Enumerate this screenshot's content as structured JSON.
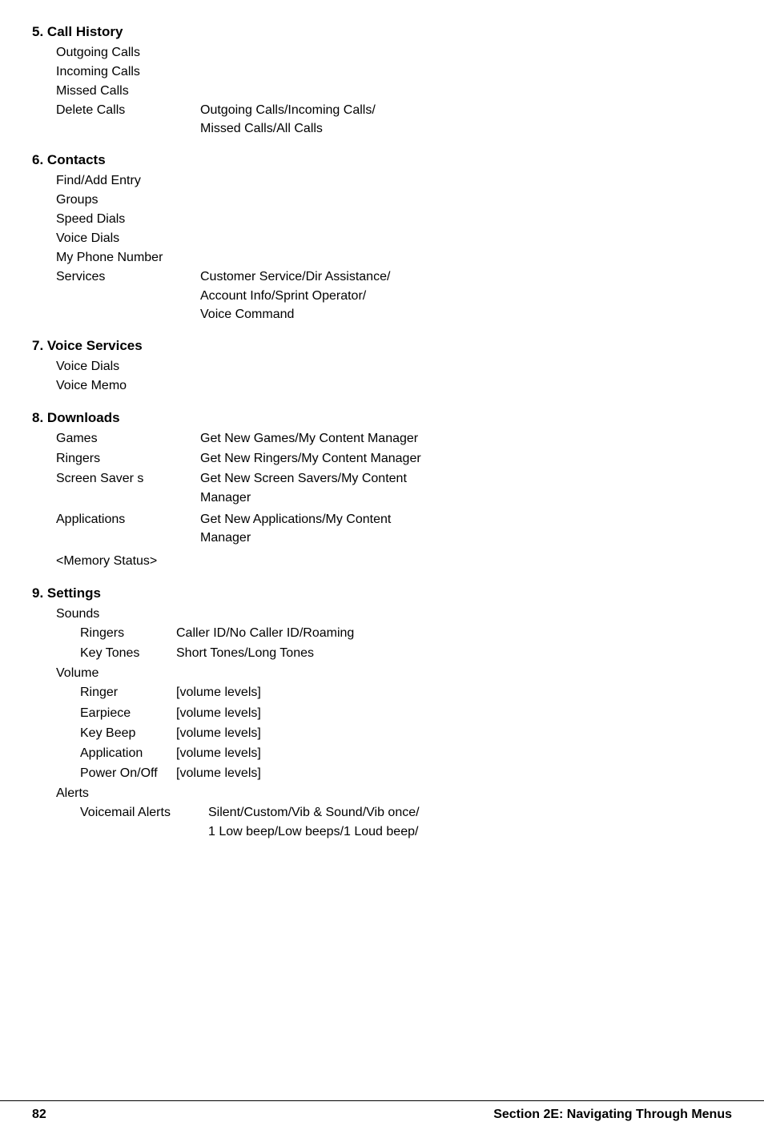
{
  "sections": [
    {
      "id": "s5",
      "number": "5.",
      "title": "Call History",
      "items": [
        {
          "label": "Outgoing Calls",
          "value": ""
        },
        {
          "label": "Incoming Calls",
          "value": ""
        },
        {
          "label": "Missed Calls",
          "value": ""
        },
        {
          "label": "Delete Calls",
          "value": "Outgoing Calls/Incoming Calls/\nMissed Calls/All Calls"
        }
      ]
    },
    {
      "id": "s6",
      "number": "6.",
      "title": "Contacts",
      "items": [
        {
          "label": "Find/Add Entry",
          "value": ""
        },
        {
          "label": "Groups",
          "value": ""
        },
        {
          "label": "Speed Dials",
          "value": ""
        },
        {
          "label": "Voice Dials",
          "value": ""
        },
        {
          "label": "My Phone Number",
          "value": ""
        },
        {
          "label": "Services",
          "value": "Customer Service/Dir Assistance/\nAccount Info/Sprint Operator/\nVoice Command"
        }
      ]
    },
    {
      "id": "s7",
      "number": "7.",
      "title": "Voice Services",
      "items": [
        {
          "label": "Voice Dials",
          "value": ""
        },
        {
          "label": "Voice Memo",
          "value": ""
        }
      ]
    },
    {
      "id": "s8",
      "number": "8.",
      "title": "Downloads",
      "items": [
        {
          "label": "Games",
          "value": "Get New Games/My Content Manager"
        },
        {
          "label": "Ringers",
          "value": "Get New Ringers/My Content Manager"
        },
        {
          "label": "Screen Saver s",
          "value": "Get New Screen Savers/My Content\nManager"
        },
        {
          "label": "Applications",
          "value": "Get New Applications/My Content\nManager"
        },
        {
          "label": "<Memory Status>",
          "value": ""
        }
      ]
    },
    {
      "id": "s9",
      "number": "9.",
      "title": "Settings",
      "sounds": {
        "label": "Sounds",
        "items": [
          {
            "label": "Ringers",
            "value": "Caller ID/No Caller ID/Roaming"
          },
          {
            "label": "Key Tones",
            "value": "Short Tones/Long Tones"
          }
        ]
      },
      "volume": {
        "label": "Volume",
        "items": [
          {
            "label": "Ringer",
            "value": "[volume levels]"
          },
          {
            "label": "Earpiece",
            "value": "[volume levels]"
          },
          {
            "label": "Key Beep",
            "value": "[volume levels]"
          },
          {
            "label": "Application",
            "value": "[volume levels]"
          },
          {
            "label": "Power On/Off",
            "value": "[volume levels]"
          }
        ]
      },
      "alerts": {
        "label": "Alerts",
        "items": [
          {
            "label": "Voicemail Alerts",
            "value": "Silent/Custom/Vib & Sound/Vib once/\n1 Low beep/Low beeps/1 Loud beep/"
          }
        ]
      }
    }
  ],
  "footer": {
    "page": "82",
    "title": "Section 2E: Navigating Through Menus"
  }
}
